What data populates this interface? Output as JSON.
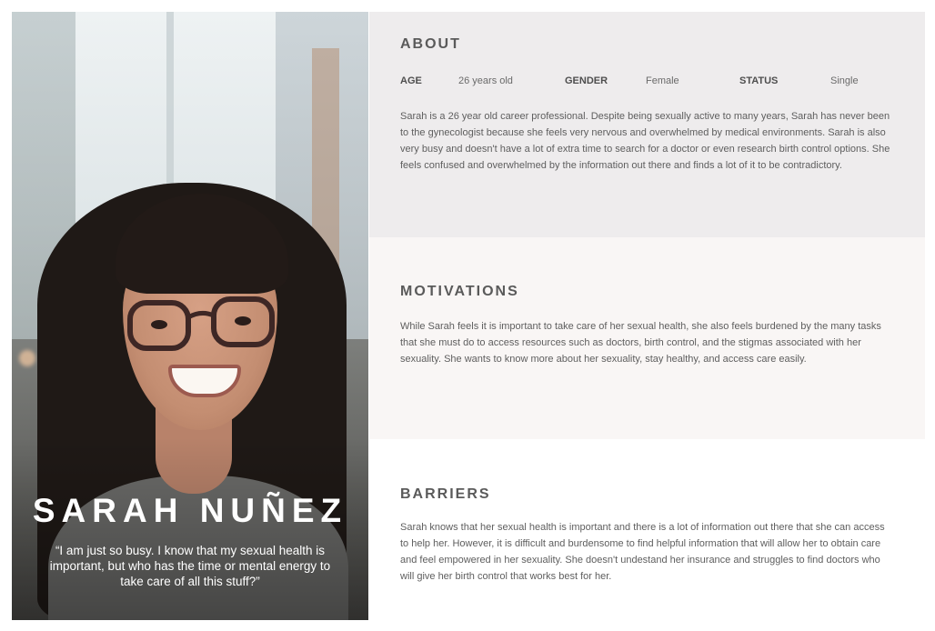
{
  "persona": {
    "name": "SARAH NUÑEZ",
    "quote": "“I am just so busy. I know that my sexual health is important, but who has the time or mental energy to take care of all this stuff?”"
  },
  "about": {
    "heading": "ABOUT",
    "age_label": "AGE",
    "age_value": "26 years old",
    "gender_label": "GENDER",
    "gender_value": "Female",
    "status_label": "STATUS",
    "status_value": "Single",
    "text": "Sarah is a 26 year old career professional. Despite being sexually active to many years, Sarah has never been to the gynecologist because she feels very nervous and overwhelmed by medical environments. Sarah is also very busy and doesn't have a lot of extra time to search for a doctor or even research birth control options. She feels confused and overwhelmed by the information out there and finds a lot of it to be contradictory."
  },
  "motivations": {
    "heading": "MOTIVATIONS",
    "text": "While Sarah feels it is important to take care of her sexual health, she also feels burdened by the many tasks that she must do to access resources such as doctors, birth control, and the stigmas associated with her sexuality. She wants to know more about her sexuality, stay healthy, and access care easily."
  },
  "barriers": {
    "heading": "BARRIERS",
    "text": "Sarah knows that her sexual health is important and there is a lot of information out there that she can access to help her. However, it is difficult and burdensome to find helpful information that will allow her to obtain care and feel empowered in her sexuality. She doesn't undestand her insurance and struggles to find doctors who will give her birth control that works best for her."
  },
  "colors": {
    "about_bg": "#eeeced",
    "motivations_bg": "#f9f6f5",
    "barriers_bg": "#ffffff",
    "heading": "#5a5a5a"
  }
}
